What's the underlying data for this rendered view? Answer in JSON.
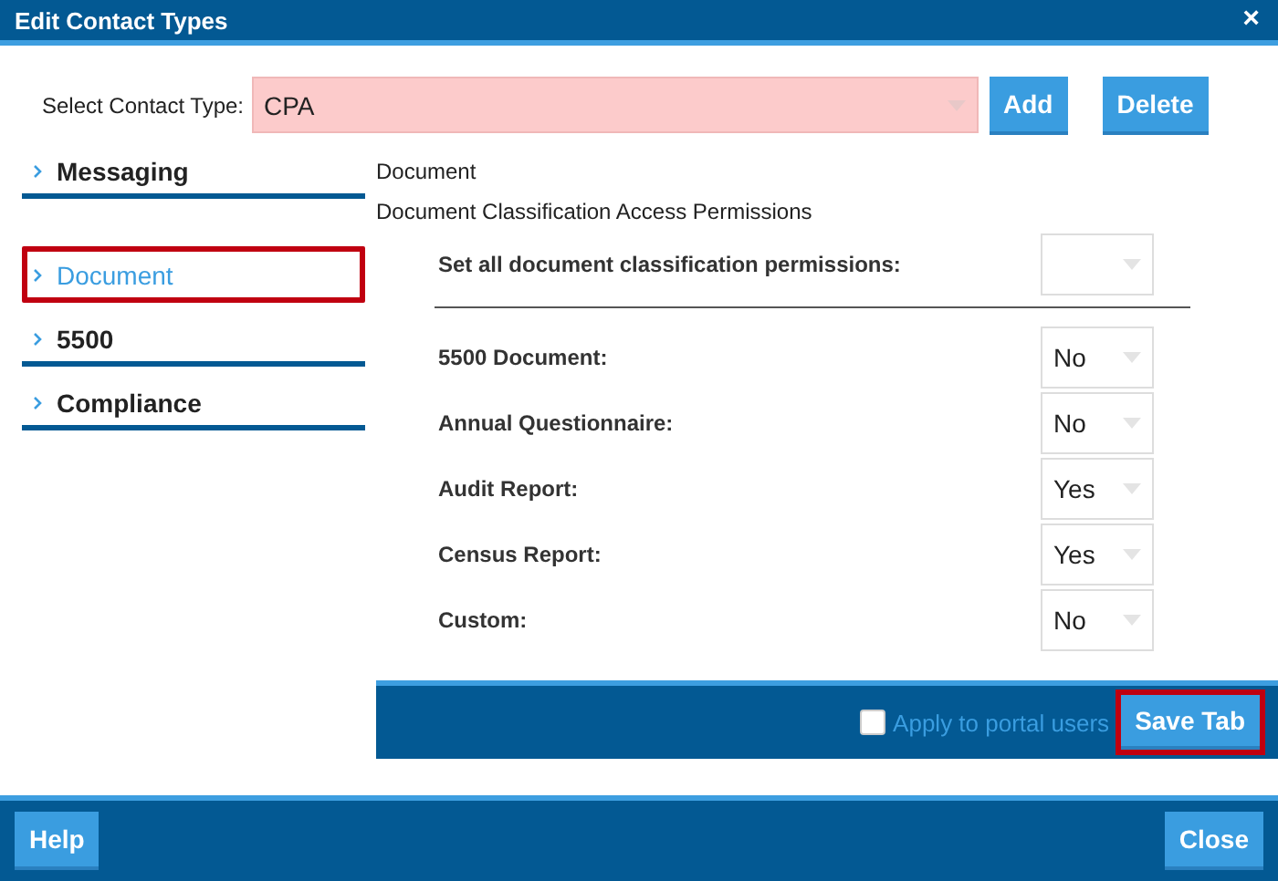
{
  "window": {
    "title": "Edit Contact Types",
    "close": "×"
  },
  "contact_type": {
    "label": "Select Contact Type:",
    "value": "CPA"
  },
  "top_buttons": [
    "Add",
    "Delete"
  ],
  "sidebar": {
    "items": [
      {
        "label": "Messaging",
        "selected": false
      },
      {
        "label": "Document",
        "selected": true
      },
      {
        "label": "5500",
        "selected": false
      },
      {
        "label": "Compliance",
        "selected": false
      }
    ]
  },
  "content": {
    "heading": "Document",
    "subheading": "Document Classification Access Permissions",
    "set_all": {
      "label": "Set all document classification permissions:"
    },
    "permissions": [
      {
        "label": "5500 Document:",
        "value": "No"
      },
      {
        "label": "Annual Questionnaire:",
        "value": "No"
      },
      {
        "label": "Audit Report:",
        "value": "Yes"
      },
      {
        "label": "Census Report:",
        "value": "Yes"
      },
      {
        "label": "Custom:",
        "value": "No"
      }
    ]
  },
  "save_bar": {
    "checkbox": {
      "label": "Apply to portal users",
      "checked": false
    },
    "button": {
      "label": "Save Tab",
      "highlighted": true
    }
  },
  "footer": {
    "buttons": [
      "Help",
      "Close"
    ]
  }
}
